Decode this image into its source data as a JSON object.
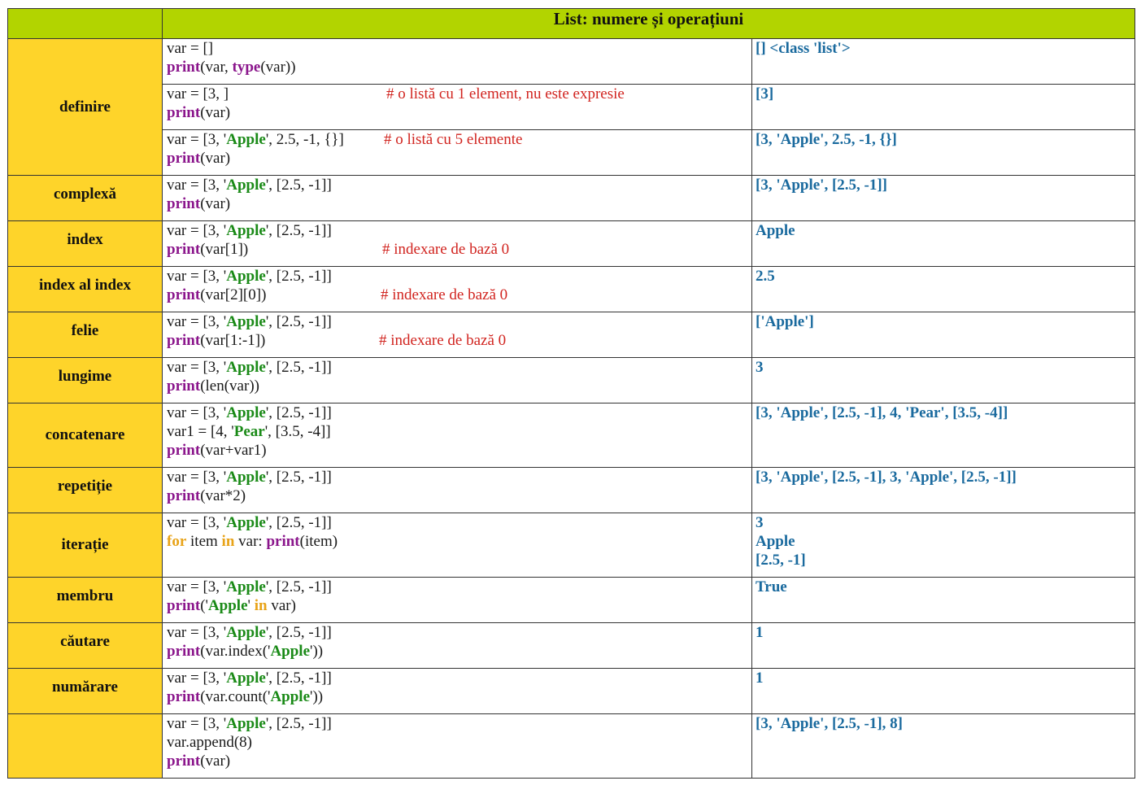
{
  "title": "List: numere și operațiuni",
  "rows": [
    {
      "label": "definire",
      "code": [
        [
          [
            {
              "t": "var = []",
              "c": ""
            }
          ]
        ],
        [
          [
            {
              "t": "print",
              "c": "kw"
            },
            {
              "t": "(var, ",
              "c": ""
            },
            {
              "t": "type",
              "c": "kw"
            },
            {
              "t": "(var))",
              "c": ""
            }
          ]
        ]
      ],
      "comment": [],
      "output": [
        "[] <class 'list'>"
      ]
    },
    {
      "label": "",
      "code": [
        [
          [
            {
              "t": "var = [3, ]",
              "c": ""
            }
          ]
        ],
        [
          [
            {
              "t": "print",
              "c": "kw"
            },
            {
              "t": "(var)",
              "c": ""
            }
          ]
        ]
      ],
      "comment": [
        "# o listă cu 1 element, nu este expresie",
        ""
      ],
      "output": [
        "[3]"
      ]
    },
    {
      "label": "",
      "code": [
        [
          [
            {
              "t": "var = [3, '",
              "c": ""
            },
            {
              "t": "Apple",
              "c": "str"
            },
            {
              "t": "', 2.5, -1, {}]",
              "c": ""
            }
          ]
        ],
        [
          [
            {
              "t": "print",
              "c": "kw"
            },
            {
              "t": "(var)",
              "c": ""
            }
          ]
        ]
      ],
      "comment": [
        "# o listă cu 5 elemente",
        ""
      ],
      "output": [
        "[3, 'Apple', 2.5, -1, {}]"
      ]
    },
    {
      "label": "complexă",
      "code": [
        [
          [
            {
              "t": "var = [3, '",
              "c": ""
            },
            {
              "t": "Apple",
              "c": "str"
            },
            {
              "t": "', [2.5, -1]]",
              "c": ""
            }
          ]
        ],
        [
          [
            {
              "t": "print",
              "c": "kw"
            },
            {
              "t": "(var)",
              "c": ""
            }
          ]
        ]
      ],
      "comment": [],
      "output": [
        "[3, 'Apple', [2.5, -1]]"
      ]
    },
    {
      "label": "index",
      "code": [
        [
          [
            {
              "t": "var = [3, '",
              "c": ""
            },
            {
              "t": "Apple",
              "c": "str"
            },
            {
              "t": "', [2.5, -1]]",
              "c": ""
            }
          ]
        ],
        [
          [
            {
              "t": "print",
              "c": "kw"
            },
            {
              "t": "(var[1])",
              "c": ""
            }
          ]
        ]
      ],
      "comment": [
        "",
        "# indexare de bază 0"
      ],
      "output": [
        "Apple"
      ]
    },
    {
      "label": "index al index",
      "code": [
        [
          [
            {
              "t": "var = [3, '",
              "c": ""
            },
            {
              "t": "Apple",
              "c": "str"
            },
            {
              "t": "', [2.5, -1]]",
              "c": ""
            }
          ]
        ],
        [
          [
            {
              "t": "print",
              "c": "kw"
            },
            {
              "t": "(var[2][0])",
              "c": ""
            }
          ]
        ]
      ],
      "comment": [
        "",
        "# indexare de bază 0"
      ],
      "output": [
        "2.5"
      ]
    },
    {
      "label": "felie",
      "code": [
        [
          [
            {
              "t": "var = [3, '",
              "c": ""
            },
            {
              "t": "Apple",
              "c": "str"
            },
            {
              "t": "', [2.5, -1]]",
              "c": ""
            }
          ]
        ],
        [
          [
            {
              "t": "print",
              "c": "kw"
            },
            {
              "t": "(var[1:-1])",
              "c": ""
            }
          ]
        ]
      ],
      "comment": [
        "",
        "# indexare de bază 0"
      ],
      "output": [
        "['Apple']"
      ]
    },
    {
      "label": "lungime",
      "code": [
        [
          [
            {
              "t": "var = [3, '",
              "c": ""
            },
            {
              "t": "Apple",
              "c": "str"
            },
            {
              "t": "', [2.5, -1]]",
              "c": ""
            }
          ]
        ],
        [
          [
            {
              "t": "print",
              "c": "kw"
            },
            {
              "t": "(len(var))",
              "c": ""
            }
          ]
        ]
      ],
      "comment": [],
      "output": [
        "3"
      ]
    },
    {
      "label": "concatenare",
      "code": [
        [
          [
            {
              "t": "var = [3, '",
              "c": ""
            },
            {
              "t": "Apple",
              "c": "str"
            },
            {
              "t": "', [2.5, -1]]",
              "c": ""
            }
          ]
        ],
        [
          [
            {
              "t": "var1 = [4, '",
              "c": ""
            },
            {
              "t": "Pear",
              "c": "str"
            },
            {
              "t": "', [3.5, -4]]",
              "c": ""
            }
          ]
        ],
        [
          [
            {
              "t": "print",
              "c": "kw"
            },
            {
              "t": "(var+var1)",
              "c": ""
            }
          ]
        ]
      ],
      "comment": [],
      "output": [
        "[3, 'Apple', [2.5, -1], 4, 'Pear', [3.5, -4]]"
      ]
    },
    {
      "label": "repetiție",
      "code": [
        [
          [
            {
              "t": "var = [3, '",
              "c": ""
            },
            {
              "t": "Apple",
              "c": "str"
            },
            {
              "t": "', [2.5, -1]]",
              "c": ""
            }
          ]
        ],
        [
          [
            {
              "t": "print",
              "c": "kw"
            },
            {
              "t": "(var*2)",
              "c": ""
            }
          ]
        ]
      ],
      "comment": [],
      "output": [
        "[3, 'Apple', [2.5, -1], 3, 'Apple', [2.5, -1]]"
      ]
    },
    {
      "label": "iterație",
      "code": [
        [
          [
            {
              "t": "var = [3, '",
              "c": ""
            },
            {
              "t": "Apple",
              "c": "str"
            },
            {
              "t": "', [2.5, -1]]",
              "c": ""
            }
          ]
        ],
        [
          [
            {
              "t": "for",
              "c": "ctl"
            },
            {
              "t": " item ",
              "c": ""
            },
            {
              "t": "in",
              "c": "ctl"
            },
            {
              "t": " var: ",
              "c": ""
            },
            {
              "t": "print",
              "c": "kw"
            },
            {
              "t": "(item)",
              "c": ""
            }
          ]
        ]
      ],
      "comment": [],
      "output": [
        "3",
        "Apple",
        "[2.5, -1]"
      ]
    },
    {
      "label": "membru",
      "code": [
        [
          [
            {
              "t": "var = [3, '",
              "c": ""
            },
            {
              "t": "Apple",
              "c": "str"
            },
            {
              "t": "', [2.5, -1]]",
              "c": ""
            }
          ]
        ],
        [
          [
            {
              "t": "print",
              "c": "kw"
            },
            {
              "t": "('",
              "c": ""
            },
            {
              "t": "Apple",
              "c": "str"
            },
            {
              "t": "' ",
              "c": ""
            },
            {
              "t": "in",
              "c": "ctl"
            },
            {
              "t": " var)",
              "c": ""
            }
          ]
        ]
      ],
      "comment": [],
      "output": [
        "True"
      ]
    },
    {
      "label": "căutare",
      "code": [
        [
          [
            {
              "t": "var = [3, '",
              "c": ""
            },
            {
              "t": "Apple",
              "c": "str"
            },
            {
              "t": "', [2.5, -1]]",
              "c": ""
            }
          ]
        ],
        [
          [
            {
              "t": "print",
              "c": "kw"
            },
            {
              "t": "(var.index('",
              "c": ""
            },
            {
              "t": "Apple",
              "c": "str"
            },
            {
              "t": "'))",
              "c": ""
            }
          ]
        ]
      ],
      "comment": [],
      "output": [
        "1"
      ]
    },
    {
      "label": "numărare",
      "code": [
        [
          [
            {
              "t": "var = [3, '",
              "c": ""
            },
            {
              "t": "Apple",
              "c": "str"
            },
            {
              "t": "', [2.5, -1]]",
              "c": ""
            }
          ]
        ],
        [
          [
            {
              "t": "print",
              "c": "kw"
            },
            {
              "t": "(var.count('",
              "c": ""
            },
            {
              "t": "Apple",
              "c": "str"
            },
            {
              "t": "'))",
              "c": ""
            }
          ]
        ]
      ],
      "comment": [],
      "output": [
        "1"
      ]
    },
    {
      "label": "",
      "code": [
        [
          [
            {
              "t": "var = [3, '",
              "c": ""
            },
            {
              "t": "Apple",
              "c": "str"
            },
            {
              "t": "', [2.5, -1]]",
              "c": ""
            }
          ]
        ],
        [
          [
            {
              "t": "var.append(8)",
              "c": ""
            }
          ]
        ],
        [
          [
            {
              "t": "print",
              "c": "kw"
            },
            {
              "t": "(var)",
              "c": ""
            }
          ]
        ]
      ],
      "comment": [],
      "output": [
        "[3, 'Apple', [2.5, -1], 8]"
      ]
    }
  ]
}
